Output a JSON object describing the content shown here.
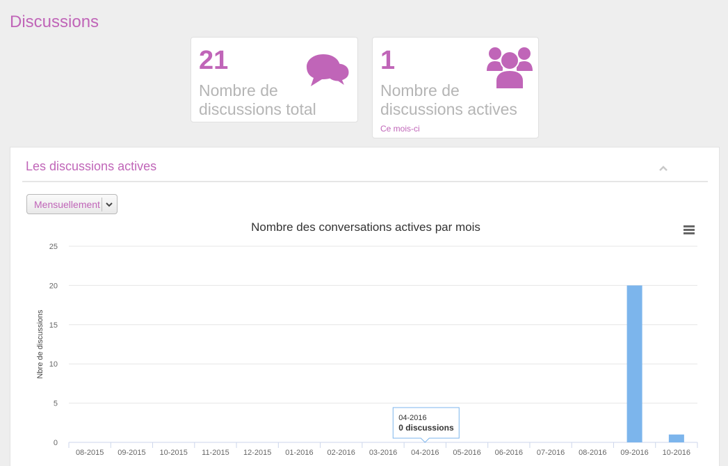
{
  "page": {
    "title": "Discussions"
  },
  "stats": [
    {
      "number": "21",
      "label": "Nombre de discussions total",
      "icon": "comments-icon"
    },
    {
      "number": "1",
      "label": "Nombre de discussions actives",
      "sub": "Ce mois-ci",
      "icon": "users-icon"
    }
  ],
  "panel": {
    "title": "Les discussions actives",
    "collapse_icon": "chevron-up-icon",
    "period_select": {
      "value": "Mensuellement"
    }
  },
  "colors": {
    "accent": "#c065b8",
    "bar": "#7cb5ec",
    "muted_text": "#b5b5b5"
  },
  "chart_data": {
    "type": "bar",
    "title": "Nombre des conversations actives par mois",
    "xlabel": "",
    "ylabel": "Nbre de discussions",
    "categories": [
      "08-2015",
      "09-2015",
      "10-2015",
      "11-2015",
      "12-2015",
      "01-2016",
      "02-2016",
      "03-2016",
      "04-2016",
      "05-2016",
      "06-2016",
      "07-2016",
      "08-2016",
      "09-2016",
      "10-2016"
    ],
    "values": [
      0,
      0,
      0,
      0,
      0,
      0,
      0,
      0,
      0,
      0,
      0,
      0,
      0,
      20,
      1
    ],
    "ylim": [
      0,
      25
    ],
    "yticks": [
      0,
      5,
      10,
      15,
      20,
      25
    ],
    "grid": true,
    "menu_icon": "hamburger-menu-icon",
    "tooltip": {
      "category": "04-2016",
      "text": "0 discussions"
    }
  }
}
